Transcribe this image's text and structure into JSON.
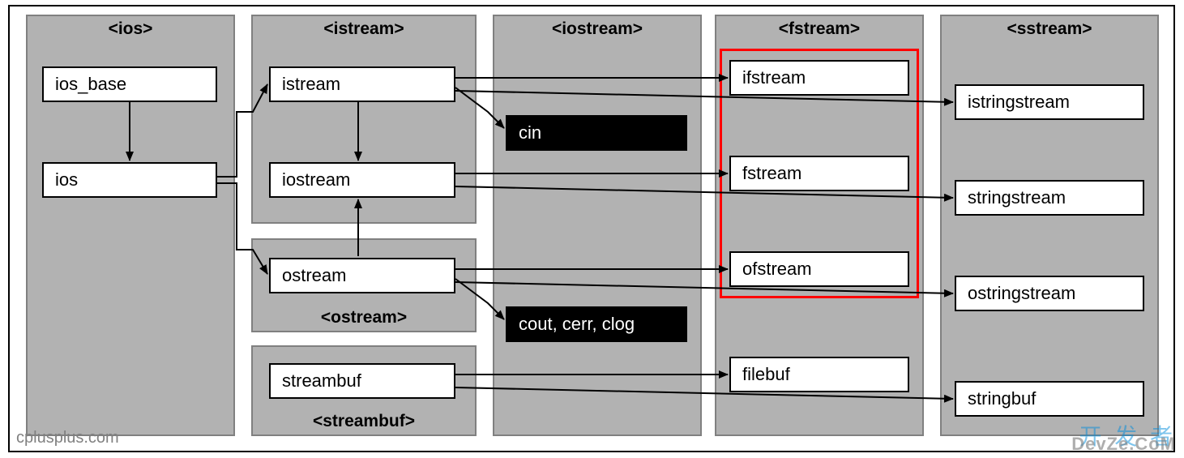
{
  "diagram": {
    "source_watermark": "cplusplus.com",
    "brand_watermark_cn": "开 发 者",
    "brand_watermark_en": "DevZe.CoM",
    "groups": {
      "ios": {
        "title": "<ios>"
      },
      "istream": {
        "title": "<istream>"
      },
      "ostream": {
        "title": "<ostream>"
      },
      "streambuf": {
        "title": "<streambuf>"
      },
      "iostream": {
        "title": "<iostream>"
      },
      "fstream": {
        "title": "<fstream>"
      },
      "sstream": {
        "title": "<sstream>"
      }
    },
    "classes": {
      "ios_base": "ios_base",
      "ios": "ios",
      "istream": "istream",
      "iostream": "iostream",
      "ostream": "ostream",
      "streambuf": "streambuf",
      "ifstream": "ifstream",
      "fstream": "fstream",
      "ofstream": "ofstream",
      "filebuf": "filebuf",
      "istringstream": "istringstream",
      "stringstream": "stringstream",
      "ostringstream": "ostringstream",
      "stringbuf": "stringbuf"
    },
    "objects": {
      "cin": "cin",
      "cout": "cout, cerr, clog"
    },
    "highlight": [
      "ifstream",
      "fstream",
      "ofstream"
    ],
    "edges_inheritance": [
      [
        "ios_base",
        "ios"
      ],
      [
        "ios",
        "istream"
      ],
      [
        "ios",
        "ostream"
      ],
      [
        "istream",
        "iostream"
      ],
      [
        "ostream",
        "iostream"
      ],
      [
        "istream",
        "ifstream"
      ],
      [
        "istream",
        "istringstream"
      ],
      [
        "iostream",
        "fstream"
      ],
      [
        "iostream",
        "stringstream"
      ],
      [
        "ostream",
        "ofstream"
      ],
      [
        "ostream",
        "ostringstream"
      ],
      [
        "streambuf",
        "filebuf"
      ],
      [
        "streambuf",
        "stringbuf"
      ]
    ],
    "edges_object": [
      [
        "istream",
        "cin"
      ],
      [
        "ostream",
        "cout"
      ]
    ]
  }
}
